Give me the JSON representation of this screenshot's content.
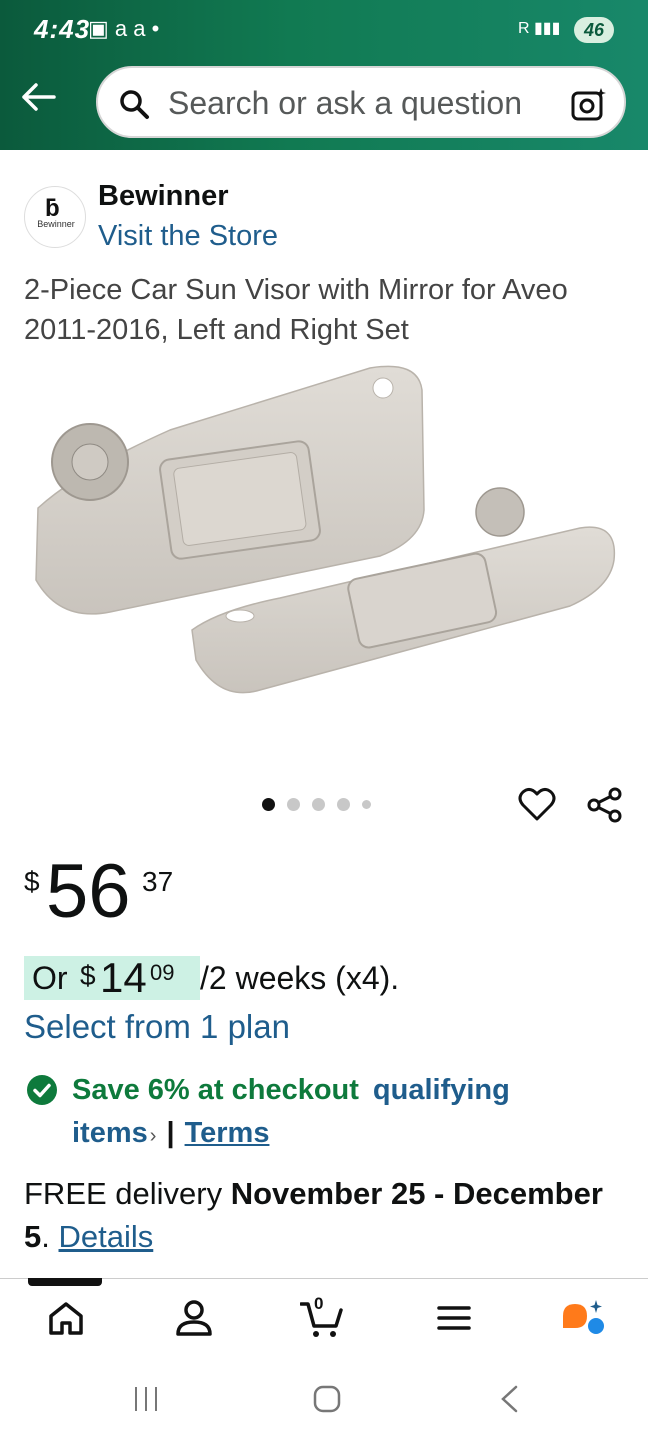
{
  "status_bar": {
    "time": "4:43",
    "notifications": "▣ a a •",
    "signal": "R ▮▮▮",
    "battery": "46"
  },
  "search": {
    "placeholder": "Search or ask a question"
  },
  "brand": {
    "logo_text": "Bewinner",
    "name": "Bewinner",
    "visit_store": "Visit the Store"
  },
  "product": {
    "title": "2-Piece Car Sun Visor with Mirror for Aveo 2011-2016, Left and Right Set",
    "image_count": 5,
    "active_image": 1
  },
  "price": {
    "currency": "$",
    "whole": "56",
    "fraction": "37"
  },
  "installment": {
    "or": "Or",
    "currency": "$",
    "whole": "14",
    "fraction": "09",
    "rest": "/2 weeks (x4).",
    "plan_link": "Select from 1 plan"
  },
  "promo": {
    "save": "Save 6% at checkout",
    "qualifying": "qualifying",
    "items": "items",
    "separator": "|",
    "terms": "Terms"
  },
  "delivery": {
    "prefix": "FREE delivery",
    "dates": "November 25 - December 5",
    "period": ".",
    "details": "Details"
  },
  "bottom_nav": {
    "cart_count": "0"
  },
  "colors": {
    "header_green": "#0b5a3c",
    "link_blue": "#1f5d8c",
    "save_green": "#0e7a3c",
    "highlight": "#cdf1e4"
  }
}
